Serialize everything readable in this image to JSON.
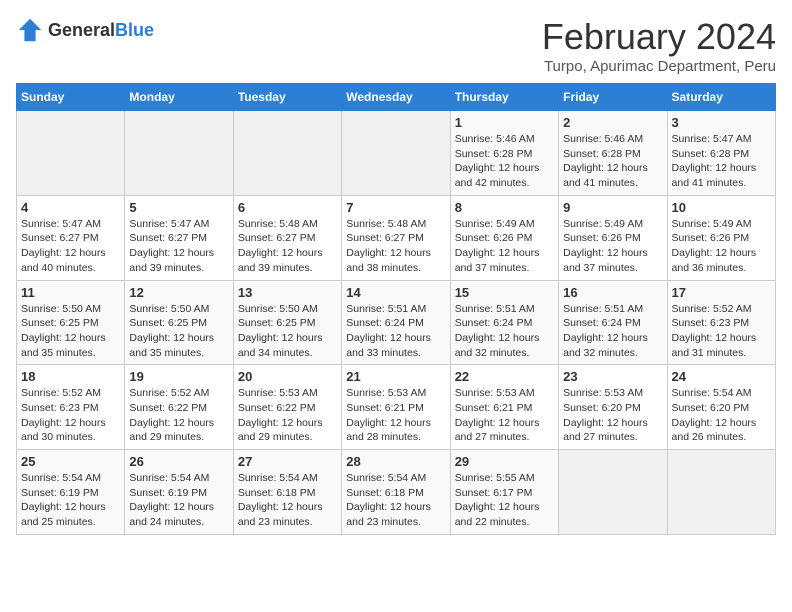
{
  "header": {
    "logo_general": "General",
    "logo_blue": "Blue",
    "month_title": "February 2024",
    "subtitle": "Turpo, Apurimac Department, Peru"
  },
  "days_of_week": [
    "Sunday",
    "Monday",
    "Tuesday",
    "Wednesday",
    "Thursday",
    "Friday",
    "Saturday"
  ],
  "weeks": [
    [
      {
        "day": "",
        "sunrise": "",
        "sunset": "",
        "daylight": "",
        "empty": true
      },
      {
        "day": "",
        "sunrise": "",
        "sunset": "",
        "daylight": "",
        "empty": true
      },
      {
        "day": "",
        "sunrise": "",
        "sunset": "",
        "daylight": "",
        "empty": true
      },
      {
        "day": "",
        "sunrise": "",
        "sunset": "",
        "daylight": "",
        "empty": true
      },
      {
        "day": "1",
        "sunrise": "Sunrise: 5:46 AM",
        "sunset": "Sunset: 6:28 PM",
        "daylight": "Daylight: 12 hours and 42 minutes.",
        "empty": false
      },
      {
        "day": "2",
        "sunrise": "Sunrise: 5:46 AM",
        "sunset": "Sunset: 6:28 PM",
        "daylight": "Daylight: 12 hours and 41 minutes.",
        "empty": false
      },
      {
        "day": "3",
        "sunrise": "Sunrise: 5:47 AM",
        "sunset": "Sunset: 6:28 PM",
        "daylight": "Daylight: 12 hours and 41 minutes.",
        "empty": false
      }
    ],
    [
      {
        "day": "4",
        "sunrise": "Sunrise: 5:47 AM",
        "sunset": "Sunset: 6:27 PM",
        "daylight": "Daylight: 12 hours and 40 minutes.",
        "empty": false
      },
      {
        "day": "5",
        "sunrise": "Sunrise: 5:47 AM",
        "sunset": "Sunset: 6:27 PM",
        "daylight": "Daylight: 12 hours and 39 minutes.",
        "empty": false
      },
      {
        "day": "6",
        "sunrise": "Sunrise: 5:48 AM",
        "sunset": "Sunset: 6:27 PM",
        "daylight": "Daylight: 12 hours and 39 minutes.",
        "empty": false
      },
      {
        "day": "7",
        "sunrise": "Sunrise: 5:48 AM",
        "sunset": "Sunset: 6:27 PM",
        "daylight": "Daylight: 12 hours and 38 minutes.",
        "empty": false
      },
      {
        "day": "8",
        "sunrise": "Sunrise: 5:49 AM",
        "sunset": "Sunset: 6:26 PM",
        "daylight": "Daylight: 12 hours and 37 minutes.",
        "empty": false
      },
      {
        "day": "9",
        "sunrise": "Sunrise: 5:49 AM",
        "sunset": "Sunset: 6:26 PM",
        "daylight": "Daylight: 12 hours and 37 minutes.",
        "empty": false
      },
      {
        "day": "10",
        "sunrise": "Sunrise: 5:49 AM",
        "sunset": "Sunset: 6:26 PM",
        "daylight": "Daylight: 12 hours and 36 minutes.",
        "empty": false
      }
    ],
    [
      {
        "day": "11",
        "sunrise": "Sunrise: 5:50 AM",
        "sunset": "Sunset: 6:25 PM",
        "daylight": "Daylight: 12 hours and 35 minutes.",
        "empty": false
      },
      {
        "day": "12",
        "sunrise": "Sunrise: 5:50 AM",
        "sunset": "Sunset: 6:25 PM",
        "daylight": "Daylight: 12 hours and 35 minutes.",
        "empty": false
      },
      {
        "day": "13",
        "sunrise": "Sunrise: 5:50 AM",
        "sunset": "Sunset: 6:25 PM",
        "daylight": "Daylight: 12 hours and 34 minutes.",
        "empty": false
      },
      {
        "day": "14",
        "sunrise": "Sunrise: 5:51 AM",
        "sunset": "Sunset: 6:24 PM",
        "daylight": "Daylight: 12 hours and 33 minutes.",
        "empty": false
      },
      {
        "day": "15",
        "sunrise": "Sunrise: 5:51 AM",
        "sunset": "Sunset: 6:24 PM",
        "daylight": "Daylight: 12 hours and 32 minutes.",
        "empty": false
      },
      {
        "day": "16",
        "sunrise": "Sunrise: 5:51 AM",
        "sunset": "Sunset: 6:24 PM",
        "daylight": "Daylight: 12 hours and 32 minutes.",
        "empty": false
      },
      {
        "day": "17",
        "sunrise": "Sunrise: 5:52 AM",
        "sunset": "Sunset: 6:23 PM",
        "daylight": "Daylight: 12 hours and 31 minutes.",
        "empty": false
      }
    ],
    [
      {
        "day": "18",
        "sunrise": "Sunrise: 5:52 AM",
        "sunset": "Sunset: 6:23 PM",
        "daylight": "Daylight: 12 hours and 30 minutes.",
        "empty": false
      },
      {
        "day": "19",
        "sunrise": "Sunrise: 5:52 AM",
        "sunset": "Sunset: 6:22 PM",
        "daylight": "Daylight: 12 hours and 29 minutes.",
        "empty": false
      },
      {
        "day": "20",
        "sunrise": "Sunrise: 5:53 AM",
        "sunset": "Sunset: 6:22 PM",
        "daylight": "Daylight: 12 hours and 29 minutes.",
        "empty": false
      },
      {
        "day": "21",
        "sunrise": "Sunrise: 5:53 AM",
        "sunset": "Sunset: 6:21 PM",
        "daylight": "Daylight: 12 hours and 28 minutes.",
        "empty": false
      },
      {
        "day": "22",
        "sunrise": "Sunrise: 5:53 AM",
        "sunset": "Sunset: 6:21 PM",
        "daylight": "Daylight: 12 hours and 27 minutes.",
        "empty": false
      },
      {
        "day": "23",
        "sunrise": "Sunrise: 5:53 AM",
        "sunset": "Sunset: 6:20 PM",
        "daylight": "Daylight: 12 hours and 27 minutes.",
        "empty": false
      },
      {
        "day": "24",
        "sunrise": "Sunrise: 5:54 AM",
        "sunset": "Sunset: 6:20 PM",
        "daylight": "Daylight: 12 hours and 26 minutes.",
        "empty": false
      }
    ],
    [
      {
        "day": "25",
        "sunrise": "Sunrise: 5:54 AM",
        "sunset": "Sunset: 6:19 PM",
        "daylight": "Daylight: 12 hours and 25 minutes.",
        "empty": false
      },
      {
        "day": "26",
        "sunrise": "Sunrise: 5:54 AM",
        "sunset": "Sunset: 6:19 PM",
        "daylight": "Daylight: 12 hours and 24 minutes.",
        "empty": false
      },
      {
        "day": "27",
        "sunrise": "Sunrise: 5:54 AM",
        "sunset": "Sunset: 6:18 PM",
        "daylight": "Daylight: 12 hours and 23 minutes.",
        "empty": false
      },
      {
        "day": "28",
        "sunrise": "Sunrise: 5:54 AM",
        "sunset": "Sunset: 6:18 PM",
        "daylight": "Daylight: 12 hours and 23 minutes.",
        "empty": false
      },
      {
        "day": "29",
        "sunrise": "Sunrise: 5:55 AM",
        "sunset": "Sunset: 6:17 PM",
        "daylight": "Daylight: 12 hours and 22 minutes.",
        "empty": false
      },
      {
        "day": "",
        "sunrise": "",
        "sunset": "",
        "daylight": "",
        "empty": true
      },
      {
        "day": "",
        "sunrise": "",
        "sunset": "",
        "daylight": "",
        "empty": true
      }
    ]
  ]
}
